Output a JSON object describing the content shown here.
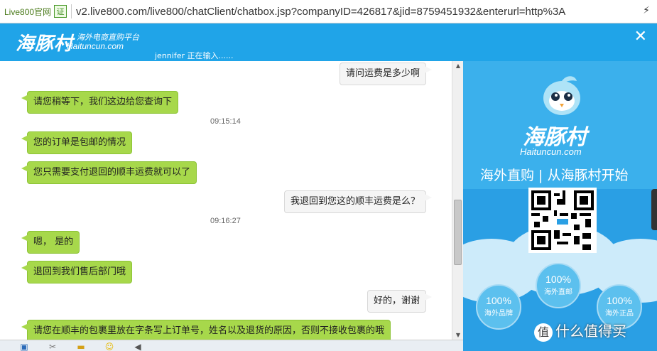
{
  "address_bar": {
    "site_label": "Live800官网",
    "cert_label": "证",
    "url": "v2.live800.com/live800/chatClient/chatbox.jsp?companyID=426817&jid=8759451932&enterurl=http%3A",
    "go_label": "⚡"
  },
  "header": {
    "logo_cn": "海豚村",
    "logo_sub1": "海外电商直购平台",
    "logo_sub2": "Haituncun.com",
    "typing_status": "jennifer 正在输入......",
    "close_label": "✕"
  },
  "messages": [
    {
      "text": "请问运费是多少啊"
    },
    {
      "text": "请您稍等下，我们这边给您查询下"
    },
    {
      "text": "09:15:14"
    },
    {
      "text": "您的订单是包邮的情况"
    },
    {
      "text": "您只需要支付退回的顺丰运费就可以了"
    },
    {
      "text": "我退回到您这的顺丰运费是么？"
    },
    {
      "text": "09:16:27"
    },
    {
      "text": "嗯， 是的"
    },
    {
      "text": "退回到我们售后部门哦"
    },
    {
      "text": "好的，谢谢"
    },
    {
      "text": "请您在顺丰的包裹里放在字条写上订单号，姓名以及退货的原因，否则不接收包裹的哦"
    }
  ],
  "ad": {
    "brand_cn": "海豚村",
    "brand_en": "Haituncun.com",
    "slogan": "海外直购 | 从海豚村开始",
    "circles": [
      {
        "pct": "100%",
        "label": "海外直邮"
      },
      {
        "pct": "100%",
        "label": "海外品牌"
      },
      {
        "pct": "100%",
        "label": "海外正品"
      }
    ],
    "watermark": "什么值得买",
    "watermark_icon": "值"
  },
  "colors": {
    "header": "#20a4e8",
    "agent_bubble": "#a7d84b",
    "user_bubble": "#f5f5f5"
  }
}
